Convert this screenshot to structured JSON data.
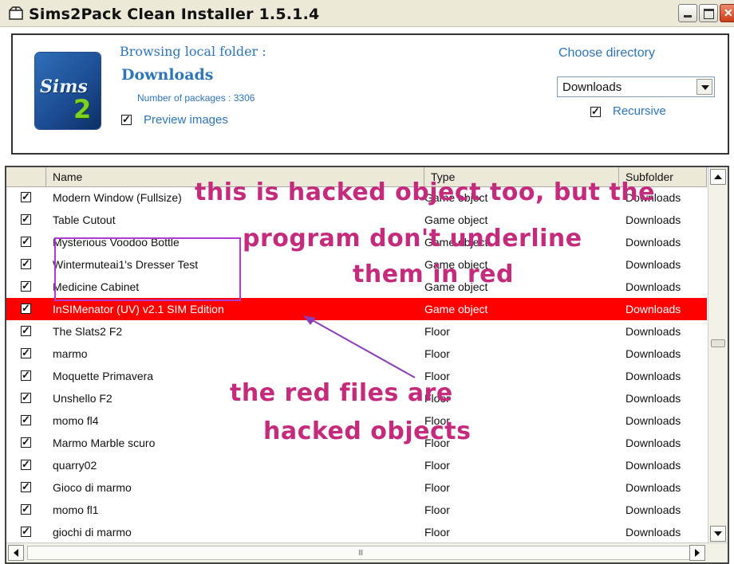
{
  "window": {
    "title": "Sims2Pack Clean Installer 1.5.1.4",
    "icon": "package-icon",
    "controls": [
      "minimize",
      "maximize",
      "close"
    ]
  },
  "header": {
    "logo_word": "Sims",
    "logo_num": "2",
    "browse_label": "Browsing local folder :",
    "folder_name": "Downloads",
    "package_count": "Number of packages : 3306",
    "preview_images_label": "Preview images",
    "preview_images_checked": true,
    "choose_directory": "Choose directory",
    "directory_value": "Downloads",
    "recursive_label": "Recursive",
    "recursive_checked": true
  },
  "list": {
    "columns": [
      "Name",
      "Type",
      "Subfolder"
    ],
    "rows": [
      {
        "name": "Modern Window (Fullsize)",
        "type": "Game object",
        "subfolder": "Downloads",
        "checked": true,
        "highlighted": false
      },
      {
        "name": "Table Cutout",
        "type": "Game object",
        "subfolder": "Downloads",
        "checked": true,
        "highlighted": false
      },
      {
        "name": "Mysterious Voodoo Bottle",
        "type": "Game object",
        "subfolder": "Downloads",
        "checked": true,
        "highlighted": false
      },
      {
        "name": "Wintermuteai1's Dresser Test",
        "type": "Game object",
        "subfolder": "Downloads",
        "checked": true,
        "highlighted": false
      },
      {
        "name": "Medicine Cabinet",
        "type": "Game object",
        "subfolder": "Downloads",
        "checked": true,
        "highlighted": false
      },
      {
        "name": "InSIMenator (UV) v2.1 SIM Edition",
        "type": "Game object",
        "subfolder": "Downloads",
        "checked": true,
        "highlighted": true
      },
      {
        "name": "The Slats2 F2",
        "type": "Floor",
        "subfolder": "Downloads",
        "checked": true,
        "highlighted": false
      },
      {
        "name": "marmo",
        "type": "Floor",
        "subfolder": "Downloads",
        "checked": true,
        "highlighted": false
      },
      {
        "name": "Moquette Primavera",
        "type": "Floor",
        "subfolder": "Downloads",
        "checked": true,
        "highlighted": false
      },
      {
        "name": "Unshello F2",
        "type": "Floor",
        "subfolder": "Downloads",
        "checked": true,
        "highlighted": false
      },
      {
        "name": "momo fl4",
        "type": "Floor",
        "subfolder": "Downloads",
        "checked": true,
        "highlighted": false
      },
      {
        "name": "Marmo Marble scuro",
        "type": "Floor",
        "subfolder": "Downloads",
        "checked": true,
        "highlighted": false
      },
      {
        "name": "quarry02",
        "type": "Floor",
        "subfolder": "Downloads",
        "checked": true,
        "highlighted": false
      },
      {
        "name": "Gioco di marmo",
        "type": "Floor",
        "subfolder": "Downloads",
        "checked": true,
        "highlighted": false
      },
      {
        "name": "momo fl1",
        "type": "Floor",
        "subfolder": "Downloads",
        "checked": true,
        "highlighted": false
      },
      {
        "name": "giochi di marmo",
        "type": "Floor",
        "subfolder": "Downloads",
        "checked": true,
        "highlighted": false
      }
    ],
    "highlight_color": "#ff0000",
    "scrollbar_grip": "III"
  },
  "annotations": {
    "line1": "this is hacked object too, but the",
    "line2": "program don't underline",
    "line3": "them in red",
    "line4": "the red files are",
    "line5": "hacked objects",
    "text_color": "#c42b7c",
    "box_color": "#b03bd0"
  }
}
